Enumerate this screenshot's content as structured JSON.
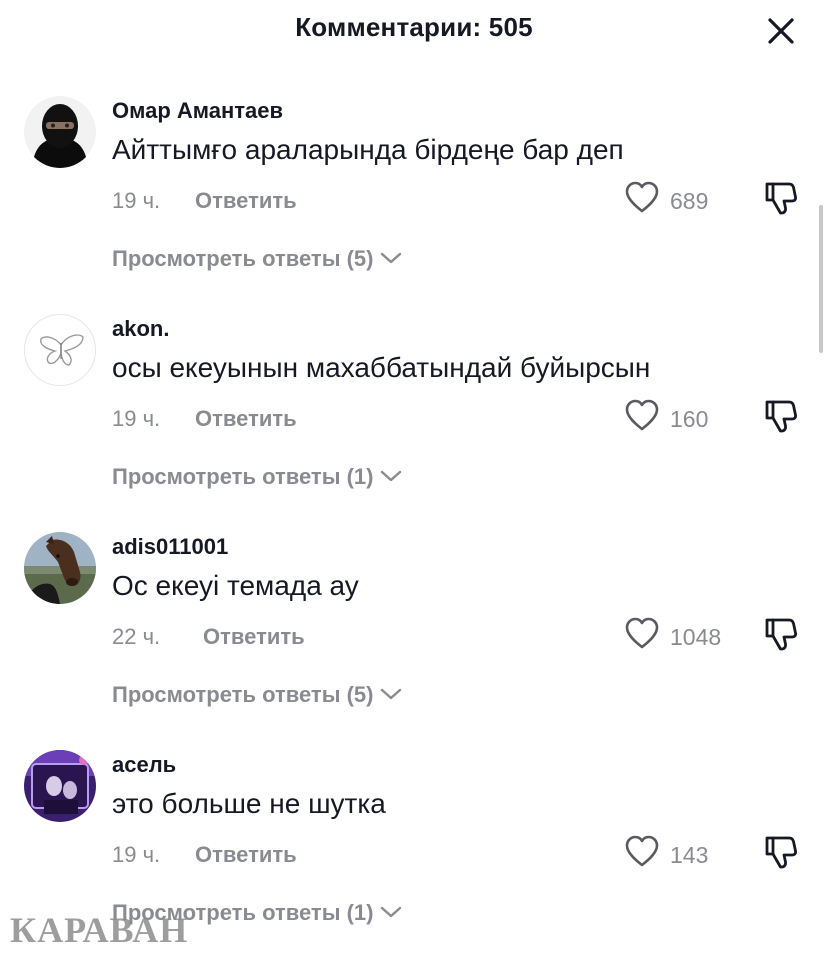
{
  "header": {
    "title": "Комментарии: 505",
    "close_icon": "close-icon"
  },
  "comments": [
    {
      "username": "Омар Амантаев",
      "text": "Айттымғо араларында бірдеңе бар деп",
      "time": "19 ч.",
      "reply_label": "Ответить",
      "likes": "689",
      "view_replies": "Просмотреть ответы (5)",
      "avatar_icon": "masked-person-avatar"
    },
    {
      "username": "akon.",
      "text": "осы екеуынын махаббатындай буйырсын",
      "time": "19 ч.",
      "reply_label": "Ответить",
      "likes": "160",
      "view_replies": "Просмотреть ответы (1)",
      "avatar_icon": "butterfly-avatar"
    },
    {
      "username": "adis011001",
      "text": "Ос екеуі темада ау",
      "time": "22 ч.",
      "reply_label": "Ответить",
      "likes": "1048",
      "view_replies": "Просмотреть ответы (5)",
      "avatar_icon": "horse-avatar"
    },
    {
      "username": "асель",
      "text": "это больше не шутка",
      "time": "19 ч.",
      "reply_label": "Ответить",
      "likes": "143",
      "view_replies": "Просмотреть ответы (1)",
      "avatar_icon": "purple-photo-avatar"
    }
  ],
  "watermark": "КАРАВАН",
  "colors": {
    "text_primary": "#161823",
    "text_secondary": "#8a8b91",
    "background": "#ffffff"
  }
}
